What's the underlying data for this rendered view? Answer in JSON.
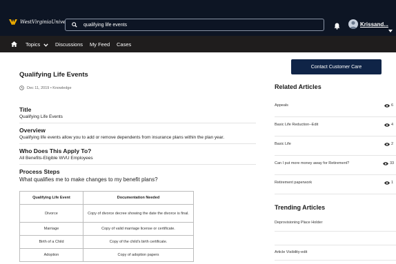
{
  "header": {
    "logo_text": "WestVirginiaUniversity.",
    "search_value": "qualifying life events",
    "user_name": "Krissand...",
    "icons": {
      "logo": "wvu-flying-wv-logo",
      "search": "search-icon",
      "bell": "bell-icon",
      "avatar": "user-avatar-icon",
      "caret": "caret-down-icon"
    }
  },
  "nav": {
    "items": [
      {
        "label": "Topics"
      },
      {
        "label": "Discussions"
      },
      {
        "label": "My Feed"
      },
      {
        "label": "Cases"
      }
    ],
    "icons": {
      "home": "home-icon",
      "topics_caret": "chevron-down-icon"
    }
  },
  "article": {
    "title": "Qualifying Life Events",
    "meta": "Dec 11, 2019 • Knowledge",
    "sections": [
      {
        "heading": "Title",
        "value": "Qualifying Life Events"
      },
      {
        "heading": "Overview",
        "value": "Qualifying life events allow you to add or remove dependents from insurance plans within the plan year."
      },
      {
        "heading": "Who Does This Apply To?",
        "value": "All Benefits-Eligible WVU Employees"
      },
      {
        "heading": "Process Steps",
        "value": ""
      }
    ],
    "question": "What qualifies me to make changes to my benefit plans?",
    "table": {
      "headers": [
        "Qualifying Life Event",
        "Documentation Needed"
      ],
      "rows": [
        [
          "Divorce",
          "Copy of divorce decree showing the date the divorce is final."
        ],
        [
          "Marriage",
          "Copy of valid marriage license or certificate."
        ],
        [
          "Birth of a Child",
          "Copy of the child's birth certificate."
        ],
        [
          "Adoption",
          "Copy of adoption papers"
        ]
      ]
    }
  },
  "sidebar": {
    "contact_button": "Contact Customer Care",
    "related_title": "Related Articles",
    "related": [
      {
        "label": "Appeals",
        "views": "6"
      },
      {
        "label": "Basic Life Reduction--Edit",
        "views": "4"
      },
      {
        "label": "Basic Life",
        "views": "2"
      },
      {
        "label": "Can I put more money away for Retirement?",
        "views": "33"
      },
      {
        "label": "Retirement paperwork",
        "views": "1"
      }
    ],
    "trending_title": "Trending Articles",
    "trending": [
      {
        "label": "Deprovisioning Place Holder"
      },
      {
        "label": "Article Visibility-edit"
      }
    ],
    "icons": {
      "views": "eye-icon"
    }
  },
  "colors": {
    "header_bg": "#0d1524",
    "nav_bg": "#1f1d1d",
    "button_bg": "#0f2447",
    "logo_gold": "#eaaa00"
  }
}
